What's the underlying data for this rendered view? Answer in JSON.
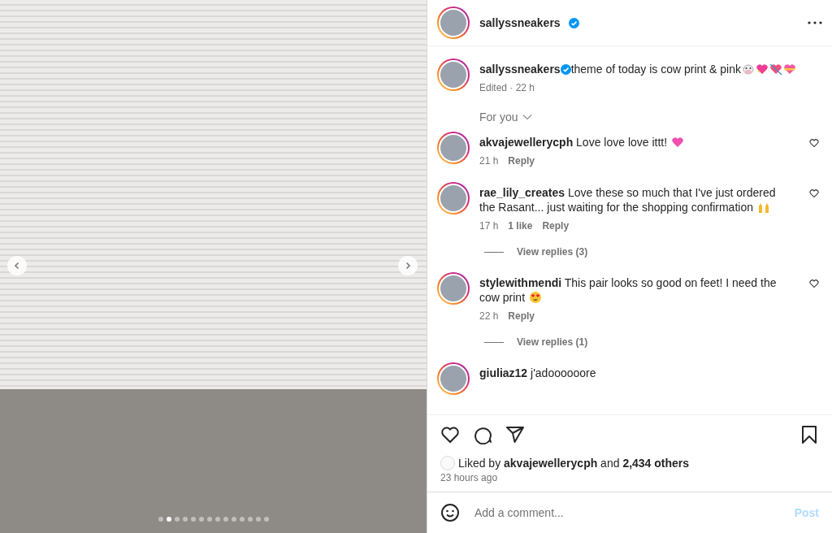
{
  "photo": {
    "dots": [
      {
        "selected": false
      },
      {
        "selected": true
      },
      {
        "selected": false
      },
      {
        "selected": false
      },
      {
        "selected": false
      },
      {
        "selected": false
      },
      {
        "selected": false
      },
      {
        "selected": false
      },
      {
        "selected": false
      },
      {
        "selected": false
      },
      {
        "selected": false
      },
      {
        "selected": false
      },
      {
        "selected": false
      },
      {
        "selected": false
      }
    ]
  },
  "header": {
    "username": "sallyssneakers",
    "verified": true
  },
  "caption": {
    "username": "sallyssneakers",
    "verified": true,
    "text": "theme of today is cow print & pink",
    "emojis": [
      {
        "kind": "cow"
      },
      {
        "kind": "sparkle-heart"
      },
      {
        "kind": "arrow-heart"
      },
      {
        "kind": "ribbon-heart"
      }
    ],
    "meta": "Edited · 22 h"
  },
  "sort": {
    "label": "For you"
  },
  "comments": [
    {
      "username": "akvajewellerycph",
      "text": "Love love love ittt!",
      "emojis": [
        {
          "kind": "heart"
        }
      ],
      "time": "21 h",
      "reply": "Reply"
    },
    {
      "username": "rae_lily_creates",
      "text": "Love these so much that I've just ordered the Rasant... just waiting for the shopping confirmation",
      "emojis": [
        {
          "kind": "raised-hands"
        }
      ],
      "time": "17 h",
      "likes": "1 like",
      "reply": "Reply",
      "view_replies": "View replies (3)"
    },
    {
      "username": "stylewithmendi",
      "text": "This pair looks so good on feet! I need the cow print",
      "emojis": [
        {
          "kind": "heart-eyes"
        }
      ],
      "time": "22 h",
      "reply": "Reply",
      "view_replies": "View replies (1)"
    },
    {
      "username": "giuliaz12",
      "text": "j'adoooooore"
    }
  ],
  "liked": {
    "text": "Liked by **akvajewellerycph** and **2,434 others**"
  },
  "time_ago": "23 hours ago",
  "comment_box": {
    "placeholder": "Add a comment...",
    "post_label": "Post",
    "post_disabled": true
  }
}
